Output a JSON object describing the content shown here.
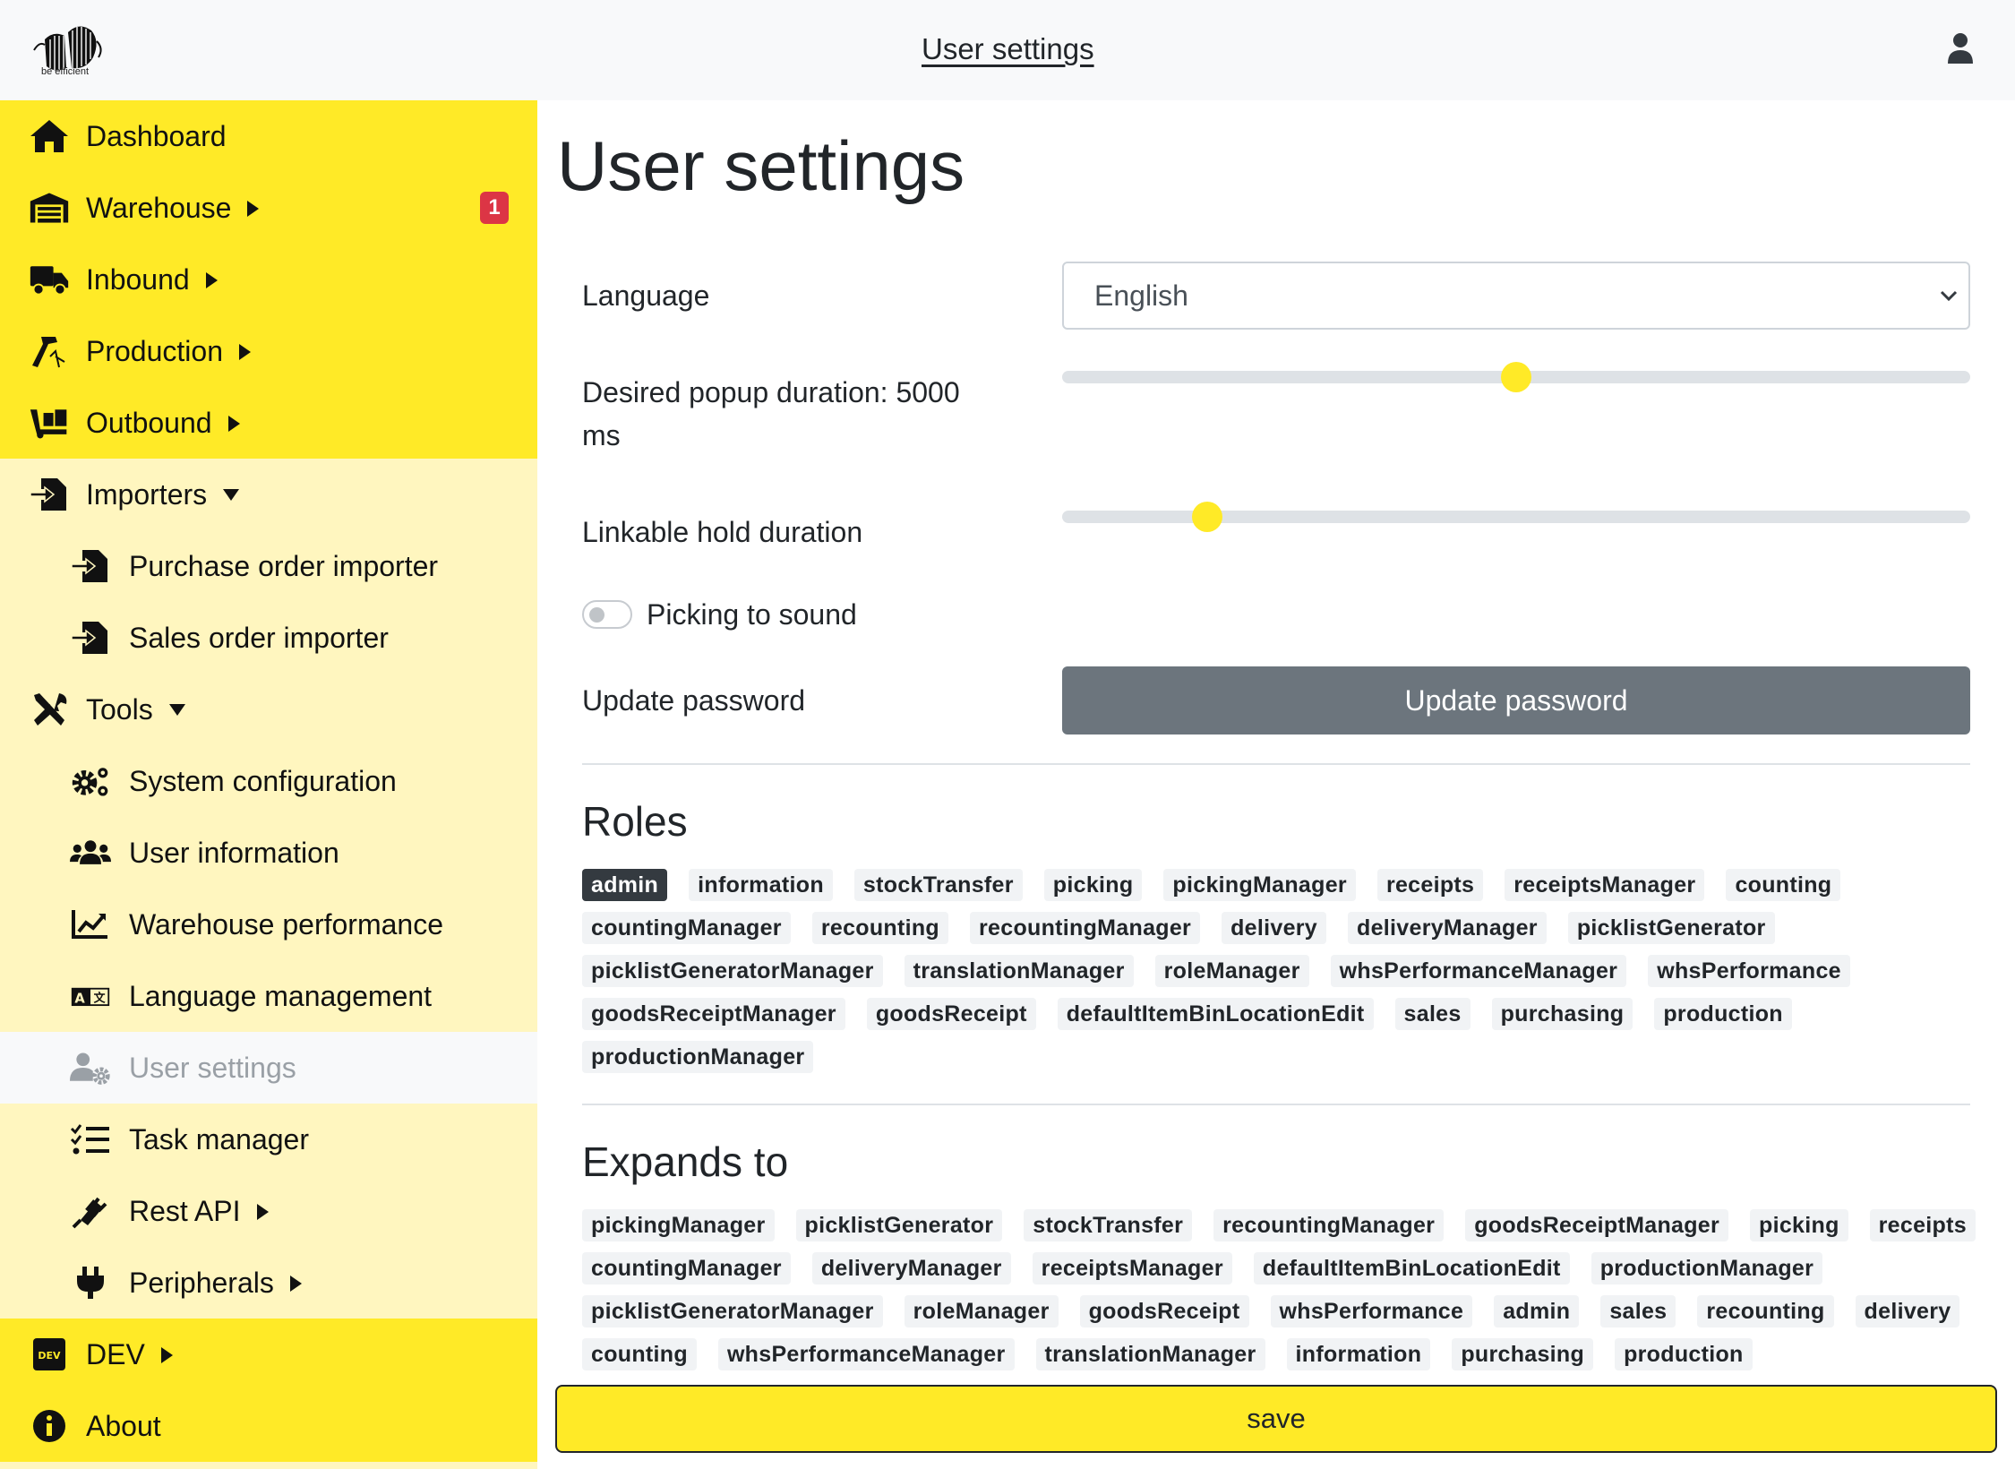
{
  "header": {
    "logo_text": "be efficient",
    "title": "User settings"
  },
  "sidebar": {
    "items": [
      {
        "label": "Dashboard",
        "icon": "home-icon"
      },
      {
        "label": "Warehouse",
        "icon": "warehouse-icon",
        "badge": "1"
      },
      {
        "label": "Inbound",
        "icon": "truck-icon"
      },
      {
        "label": "Production",
        "icon": "hammer-icon"
      },
      {
        "label": "Outbound",
        "icon": "dolly-icon"
      },
      {
        "label": "Importers",
        "icon": "file-import-icon"
      },
      {
        "label": "Purchase order importer",
        "icon": "file-import-icon"
      },
      {
        "label": "Sales order importer",
        "icon": "file-import-icon"
      },
      {
        "label": "Tools",
        "icon": "tools-icon"
      },
      {
        "label": "System configuration",
        "icon": "cogs-icon"
      },
      {
        "label": "User information",
        "icon": "users-icon"
      },
      {
        "label": "Warehouse performance",
        "icon": "chart-line-icon"
      },
      {
        "label": "Language management",
        "icon": "language-icon"
      },
      {
        "label": "User settings",
        "icon": "user-cog-icon"
      },
      {
        "label": "Task manager",
        "icon": "tasks-icon"
      },
      {
        "label": "Rest API",
        "icon": "plug-icon"
      },
      {
        "label": "Peripherals",
        "icon": "plug-icon"
      },
      {
        "label": "DEV",
        "icon": "dev-icon"
      },
      {
        "label": "About",
        "icon": "info-icon"
      }
    ]
  },
  "main": {
    "title": "User settings",
    "language_label": "Language",
    "language_value": "English",
    "popup_label_line1": "Desired popup duration: 5000",
    "popup_label_line2": "ms",
    "popup_duration_fraction": 0.5,
    "hold_label": "Linkable hold duration",
    "hold_duration_fraction": 0.16,
    "picking_sound_label": "Picking to sound",
    "picking_sound_on": false,
    "update_password_label": "Update password",
    "update_password_button": "Update password",
    "roles_title": "Roles",
    "roles": [
      "admin",
      "information",
      "stockTransfer",
      "picking",
      "pickingManager",
      "receipts",
      "receiptsManager",
      "counting",
      "countingManager",
      "recounting",
      "recountingManager",
      "delivery",
      "deliveryManager",
      "picklistGenerator",
      "picklistGeneratorManager",
      "translationManager",
      "roleManager",
      "whsPerformanceManager",
      "whsPerformance",
      "goodsReceiptManager",
      "goodsReceipt",
      "defaultItemBinLocationEdit",
      "sales",
      "purchasing",
      "production",
      "productionManager"
    ],
    "expands_title": "Expands to",
    "expands": [
      "pickingManager",
      "picklistGenerator",
      "stockTransfer",
      "recountingManager",
      "goodsReceiptManager",
      "picking",
      "receipts",
      "countingManager",
      "deliveryManager",
      "receiptsManager",
      "defaultItemBinLocationEdit",
      "productionManager",
      "picklistGeneratorManager",
      "roleManager",
      "goodsReceipt",
      "whsPerformance",
      "admin",
      "sales",
      "recounting",
      "delivery",
      "counting",
      "whsPerformanceManager",
      "translationManager",
      "information",
      "purchasing",
      "production"
    ],
    "save_button": "save"
  },
  "colors": {
    "accent_yellow": "#ffea27",
    "sidebar_light": "#fff6bf",
    "badge_red": "#dc3545",
    "button_gray": "#6c757d"
  }
}
